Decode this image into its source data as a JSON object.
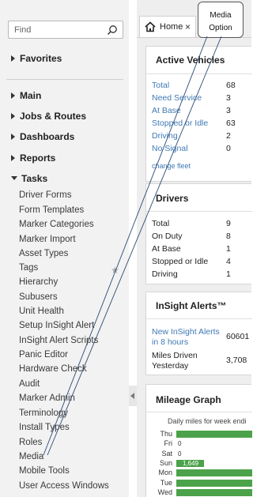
{
  "sidebar": {
    "search_placeholder": "Find",
    "sections": {
      "favorites": "Favorites",
      "main": "Main",
      "jobs_routes": "Jobs & Routes",
      "dashboards": "Dashboards",
      "reports": "Reports",
      "tasks": "Tasks"
    },
    "task_items": [
      "Driver Forms",
      "Form Templates",
      "Marker Categories",
      "Marker Import",
      "Asset Types",
      "Tags",
      "Hierarchy",
      "Subusers",
      "Unit Health",
      "Setup InSight Alert",
      "InSight Alert Scripts",
      "Panic Editor",
      "Hardware Check",
      "Audit",
      "Marker Admin",
      "Terminology",
      "Install Types",
      "Roles",
      "Media",
      "Mobile Tools",
      "User Access Windows"
    ]
  },
  "tabs": {
    "home": "Home",
    "close": "×"
  },
  "callout": {
    "line1": "Media",
    "line2": "Option"
  },
  "active_vehicles": {
    "title": "Active Vehicles",
    "rows": [
      {
        "label": "Total",
        "value": "68"
      },
      {
        "label": "Need Service",
        "value": "3"
      },
      {
        "label": "At Base",
        "value": "3"
      },
      {
        "label": "Stopped or Idle",
        "value": "63"
      },
      {
        "label": "Driving",
        "value": "2"
      },
      {
        "label": "No Signal",
        "value": "0"
      }
    ],
    "change_fleet": "change fleet"
  },
  "drivers": {
    "title": "Drivers",
    "rows": [
      {
        "label": "Total",
        "value": "9"
      },
      {
        "label": "On Duty",
        "value": "8"
      },
      {
        "label": "At Base",
        "value": "1"
      },
      {
        "label": "Stopped or Idle",
        "value": "4"
      },
      {
        "label": "Driving",
        "value": "1"
      }
    ]
  },
  "insight_alerts": {
    "title": "InSight Alerts™",
    "alerts_label_1": "New InSight Alerts",
    "alerts_label_2": "in 8 hours",
    "alerts_value": "60601",
    "miles_label_1": "Miles Driven",
    "miles_label_2": "Yesterday",
    "miles_value": "3,708"
  },
  "mileage_graph": {
    "title": "Mileage Graph",
    "subtitle": "Daily miles for week endi"
  },
  "chart_data": {
    "type": "bar",
    "orientation": "horizontal",
    "title": "Mileage Graph",
    "subtitle": "Daily miles for week endi",
    "categories": [
      "Thu",
      "Fri",
      "Sat",
      "Sun",
      "Mon",
      "Tue",
      "Wed"
    ],
    "values": [
      null,
      0,
      0,
      1649,
      null,
      null,
      null
    ],
    "value_labels": [
      "",
      "0",
      "0",
      "1,649",
      "",
      "",
      ""
    ],
    "bar_fraction_of_visible_width": [
      1.0,
      0.0,
      0.0,
      0.36,
      1.0,
      1.0,
      1.0
    ],
    "color": "#4ca24a"
  },
  "colors": {
    "link": "#3f79b5",
    "bar": "#4ca24a",
    "sidebar_bg": "#f2f2f2"
  }
}
